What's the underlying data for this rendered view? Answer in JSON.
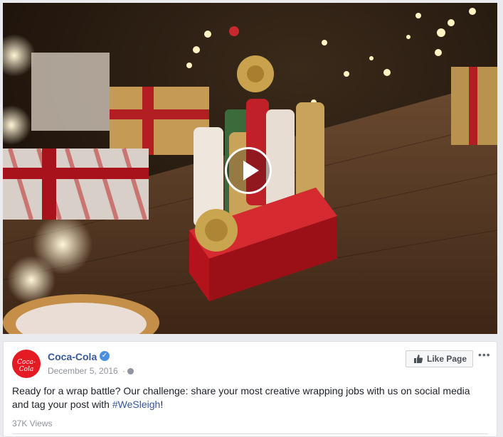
{
  "video": {
    "play_icon": "play-icon"
  },
  "post": {
    "page_name": "Coca-Cola",
    "avatar_logo_text": "Coca-Cola",
    "verified_icon": "verified-icon",
    "date": "December 5, 2016",
    "separator": "·",
    "privacy_icon": "globe-icon",
    "like_page_label": "Like Page",
    "more_icon": "more-options-icon",
    "text_before": "Ready for a wrap battle? Our challenge: share your most creative wrapping jobs with us on social media and tag your post with ",
    "hashtag": "#WeSleigh",
    "text_after": "!",
    "views": "37K Views"
  },
  "colors": {
    "brand_red": "#e41b23",
    "link": "#365899",
    "background": "#e9ebee"
  }
}
